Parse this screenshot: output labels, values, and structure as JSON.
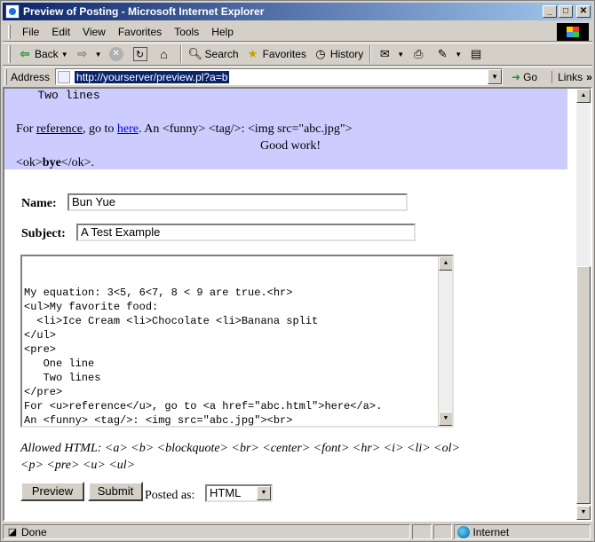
{
  "window": {
    "title": "Preview of Posting - Microsoft Internet Explorer",
    "minimize": "_",
    "maximize": "□",
    "close": "✕"
  },
  "menu": [
    "File",
    "Edit",
    "View",
    "Favorites",
    "Tools",
    "Help"
  ],
  "toolbar": {
    "back": "Back",
    "search": "Search",
    "favorites": "Favorites",
    "history": "History"
  },
  "address": {
    "label": "Address",
    "url": "http://yourserver/preview.pl?a=b",
    "go": "Go",
    "links": "Links"
  },
  "preview": {
    "mono_line": "   Two lines",
    "line2_before": "For ",
    "line2_reference": "reference",
    "line2_mid": ", go to ",
    "line2_link": "here",
    "line2_after": ". An <funny> <tag/>: <img src=\"abc.jpg\">",
    "center": "Good work!",
    "line4_before": "<ok>",
    "line4_bold": "bye",
    "line4_after": "</ok>."
  },
  "form": {
    "name_label": "Name:",
    "name_value": "Bun Yue",
    "subject_label": "Subject:",
    "subject_value": "A Test Example",
    "body": "My equation: 3<5, 6<7, 8 < 9 are true.<hr>\n<ul>My favorite food:\n  <li>Ice Cream <li>Chocolate <li>Banana split\n</ul>\n<pre>\n   One line\n   Two lines\n</pre>\nFor <u>reference</u>, go to <a href=\"abc.html\">here</a>.\nAn <funny> <tag/>: <img src=\"abc.jpg\"><br>\n<center>Good work!</center>\n<ok><b>bye</b></ok>.",
    "allowed_label": "Allowed HTML:",
    "allowed_tags": "<a> <b> <blockquote> <br> <center> <font> <hr> <i> <li> <ol> <p> <pre> <u> <ul>",
    "preview_button": "Preview",
    "submit_button": "Submit",
    "posted_as_label": "Posted as:",
    "posted_as_value": "HTML"
  },
  "status": {
    "text": "Done",
    "zone": "Internet"
  }
}
